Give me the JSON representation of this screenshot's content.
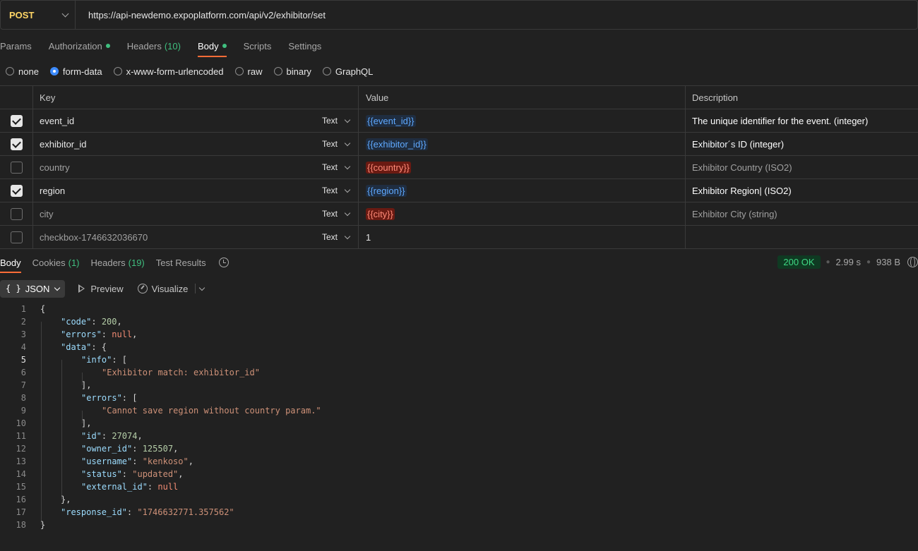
{
  "request": {
    "method": "POST",
    "url": "https://api-newdemo.expoplatform.com/api/v2/exhibitor/set"
  },
  "request_tabs": [
    {
      "label": "Params",
      "count": "",
      "dot": false,
      "active": false
    },
    {
      "label": "Authorization",
      "count": "",
      "dot": true,
      "active": false
    },
    {
      "label": "Headers",
      "count": "(10)",
      "dot": false,
      "active": false
    },
    {
      "label": "Body",
      "count": "",
      "dot": true,
      "active": true
    },
    {
      "label": "Scripts",
      "count": "",
      "dot": false,
      "active": false
    },
    {
      "label": "Settings",
      "count": "",
      "dot": false,
      "active": false
    }
  ],
  "body_types": [
    {
      "label": "none",
      "checked": false
    },
    {
      "label": "form-data",
      "checked": true
    },
    {
      "label": "x-www-form-urlencoded",
      "checked": false
    },
    {
      "label": "raw",
      "checked": false
    },
    {
      "label": "binary",
      "checked": false
    },
    {
      "label": "GraphQL",
      "checked": false
    }
  ],
  "table": {
    "headers": {
      "key": "Key",
      "value": "Value",
      "description": "Description"
    },
    "rows": [
      {
        "checked": true,
        "key": "event_id",
        "type": "Text",
        "value": "{{event_id}}",
        "value_state": "ok",
        "description": "The unique identifier for the event. (integer)"
      },
      {
        "checked": true,
        "key": "exhibitor_id",
        "type": "Text",
        "value": "{{exhibitor_id}}",
        "value_state": "ok",
        "description": "Exhibitor´s ID (integer)"
      },
      {
        "checked": false,
        "key": "country",
        "type": "Text",
        "value": "{{country}}",
        "value_state": "bad",
        "description": "Exhibitor Country (ISO2)"
      },
      {
        "checked": true,
        "key": "region",
        "type": "Text",
        "value": "{{region}}",
        "value_state": "ok",
        "description": "Exhibitor Region| (ISO2)"
      },
      {
        "checked": false,
        "key": "city",
        "type": "Text",
        "value": "{{city}}",
        "value_state": "bad",
        "description": "Exhibitor City (string)"
      },
      {
        "checked": false,
        "key": "checkbox-1746632036670",
        "type": "Text",
        "value": "1",
        "value_state": "plain",
        "description": ""
      }
    ]
  },
  "response_tabs": [
    {
      "label": "Body",
      "count": "",
      "active": true
    },
    {
      "label": "Cookies",
      "count": "(1)",
      "active": false
    },
    {
      "label": "Headers",
      "count": "(19)",
      "active": false
    },
    {
      "label": "Test Results",
      "count": "",
      "active": false
    }
  ],
  "response_meta": {
    "status": "200 OK",
    "time": "2.99 s",
    "size": "938 B",
    "status_color": "#3fd884"
  },
  "response_toolbar": {
    "format": "JSON",
    "preview": "Preview",
    "visualize": "Visualize"
  },
  "code_lines": [
    {
      "n": "1",
      "tokens": [
        [
          "p",
          "{"
        ]
      ]
    },
    {
      "n": "2",
      "indent": 1,
      "tokens": [
        [
          "k",
          "\"code\""
        ],
        [
          "p",
          ": "
        ],
        [
          "n",
          "200"
        ],
        [
          "p",
          ","
        ]
      ]
    },
    {
      "n": "3",
      "indent": 1,
      "tokens": [
        [
          "k",
          "\"errors\""
        ],
        [
          "p",
          ": "
        ],
        [
          "nl",
          "null"
        ],
        [
          "p",
          ","
        ]
      ]
    },
    {
      "n": "4",
      "indent": 1,
      "tokens": [
        [
          "k",
          "\"data\""
        ],
        [
          "p",
          ": {"
        ]
      ]
    },
    {
      "n": "5",
      "indent": 2,
      "active": true,
      "tokens": [
        [
          "k",
          "\"info\""
        ],
        [
          "p",
          ": ["
        ]
      ]
    },
    {
      "n": "6",
      "indent": 3,
      "tokens": [
        [
          "s",
          "\"Exhibitor match: exhibitor_id\""
        ]
      ]
    },
    {
      "n": "7",
      "indent": 2,
      "tokens": [
        [
          "p",
          "],"
        ]
      ]
    },
    {
      "n": "8",
      "indent": 2,
      "tokens": [
        [
          "k",
          "\"errors\""
        ],
        [
          "p",
          ": ["
        ]
      ]
    },
    {
      "n": "9",
      "indent": 3,
      "tokens": [
        [
          "s",
          "\"Cannot save region without country param.\""
        ]
      ]
    },
    {
      "n": "10",
      "indent": 2,
      "tokens": [
        [
          "p",
          "],"
        ]
      ]
    },
    {
      "n": "11",
      "indent": 2,
      "tokens": [
        [
          "k",
          "\"id\""
        ],
        [
          "p",
          ": "
        ],
        [
          "n",
          "27074"
        ],
        [
          "p",
          ","
        ]
      ]
    },
    {
      "n": "12",
      "indent": 2,
      "tokens": [
        [
          "k",
          "\"owner_id\""
        ],
        [
          "p",
          ": "
        ],
        [
          "n",
          "125507"
        ],
        [
          "p",
          ","
        ]
      ]
    },
    {
      "n": "13",
      "indent": 2,
      "tokens": [
        [
          "k",
          "\"username\""
        ],
        [
          "p",
          ": "
        ],
        [
          "s",
          "\"kenkoso\""
        ],
        [
          "p",
          ","
        ]
      ]
    },
    {
      "n": "14",
      "indent": 2,
      "tokens": [
        [
          "k",
          "\"status\""
        ],
        [
          "p",
          ": "
        ],
        [
          "s",
          "\"updated\""
        ],
        [
          "p",
          ","
        ]
      ]
    },
    {
      "n": "15",
      "indent": 2,
      "tokens": [
        [
          "k",
          "\"external_id\""
        ],
        [
          "p",
          ": "
        ],
        [
          "nl",
          "null"
        ]
      ]
    },
    {
      "n": "16",
      "indent": 1,
      "tokens": [
        [
          "p",
          "},"
        ]
      ]
    },
    {
      "n": "17",
      "indent": 1,
      "tokens": [
        [
          "k",
          "\"response_id\""
        ],
        [
          "p",
          ": "
        ],
        [
          "s",
          "\"1746632771.357562\""
        ]
      ]
    },
    {
      "n": "18",
      "tokens": [
        [
          "p",
          "}"
        ]
      ]
    }
  ]
}
